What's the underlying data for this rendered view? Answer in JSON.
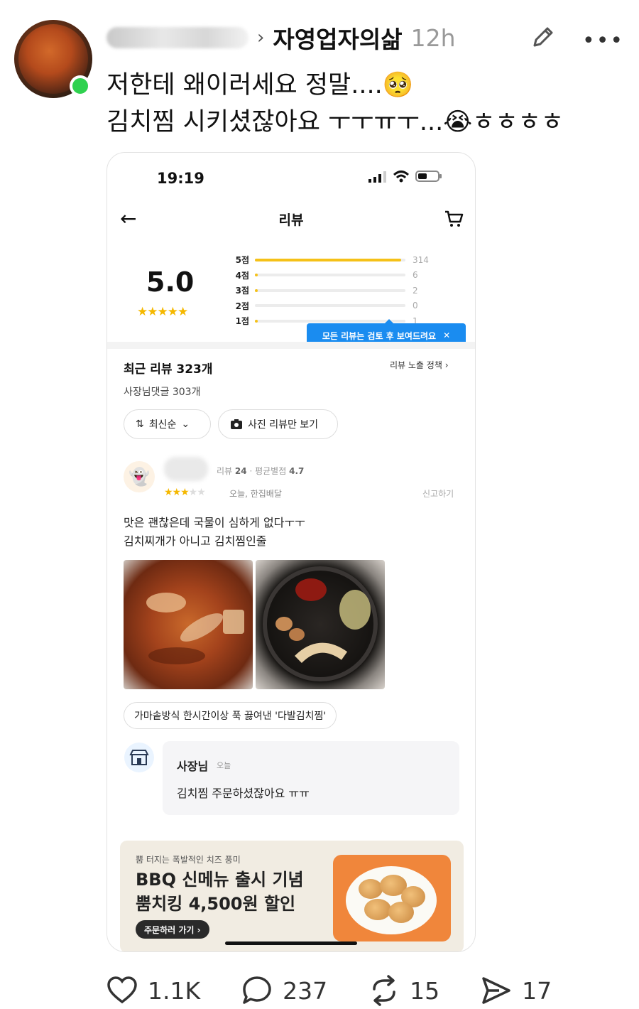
{
  "post": {
    "author_blurred": true,
    "community": "자영업자의삶",
    "time": "12h",
    "text_line1": "저한테 왜이러세요 정말....🥺",
    "text_line2": "김치찜 시키셨잖아요 ㅜㅜㅠㅜ...😭ㅎㅎㅎㅎ"
  },
  "phone": {
    "status_time": "19:19",
    "nav_title": "리뷰",
    "rating": {
      "score": "5.0",
      "stars": "★★★★★",
      "distribution": [
        {
          "label": "5점",
          "count": "314",
          "fraction": 0.97
        },
        {
          "label": "4점",
          "count": "6",
          "fraction": 0.02
        },
        {
          "label": "3점",
          "count": "2",
          "fraction": 0.006
        },
        {
          "label": "2점",
          "count": "0",
          "fraction": 0
        },
        {
          "label": "1점",
          "count": "1",
          "fraction": 0.003
        }
      ]
    },
    "tooltip": "모든 리뷰는 검토 후 보여드려요",
    "recent_reviews": "최근 리뷰 323개",
    "policy_link": "리뷰 노출 정책",
    "owner_comment_count": "사장님댓글 303개",
    "sort_label": "최신순",
    "photo_filter_label": "사진 리뷰만 보기",
    "review": {
      "meta_reviews_label": "리뷰",
      "meta_reviews_value": "24",
      "meta_avg_label": "평균별점",
      "meta_avg_value": "4.7",
      "stars_on": "★★★",
      "stars_off": "★★",
      "date_delivery": "오늘, 한집배달",
      "report": "신고하기",
      "text_line1": "맛은 괜찮은데 국물이 심하게 없다ㅜㅜ",
      "text_line2": "김치찌개가 아니고 김치찜인줄",
      "menu_tag": "가마솥방식 한시간이상 푹 끓여낸 '다발김치찜'"
    },
    "owner_reply": {
      "name": "사장님",
      "date": "오늘",
      "text": "김치찜 주문하셨잖아요 ㅠㅠ"
    },
    "ad": {
      "subtitle": "뿜 터지는 폭발적인 치즈 풍미",
      "title_line1": "BBQ 신메뉴 출시 기념",
      "title_line2": "뿜치킹 4,500원 할인",
      "button": "주문하러 가기 ›"
    }
  },
  "actions": {
    "likes": "1.1K",
    "comments": "237",
    "reposts": "15",
    "shares": "17"
  },
  "colors": {
    "online": "#2fd14f",
    "star": "#f5b800",
    "tooltip": "#1a8cf0",
    "ad_bg": "#f1ece2",
    "ad_image": "#f0863b"
  }
}
